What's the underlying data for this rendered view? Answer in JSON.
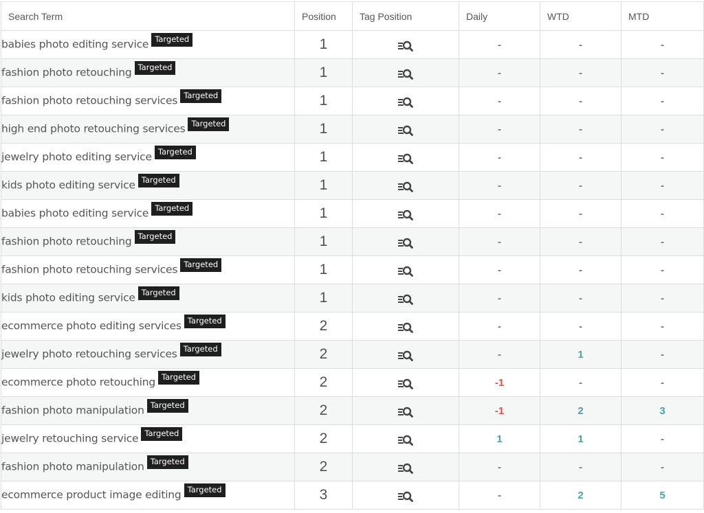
{
  "colors": {
    "positive": "#4aa3a2",
    "negative": "#d9534f",
    "badge_bg": "#1f1f1f",
    "row_alt_bg": "#f5f7f7"
  },
  "table": {
    "headers": {
      "search_term": "Search Term",
      "position": "Position",
      "tag_position": "Tag Position",
      "daily": "Daily",
      "wtd": "WTD",
      "mtd": "MTD"
    },
    "tag_icon": "list-search-icon",
    "rows": [
      {
        "term": "babies photo editing service",
        "badge": "Targeted",
        "position": "1",
        "daily": "-",
        "wtd": "-",
        "mtd": "-"
      },
      {
        "term": "fashion photo retouching",
        "badge": "Targeted",
        "position": "1",
        "daily": "-",
        "wtd": "-",
        "mtd": "-"
      },
      {
        "term": "fashion photo retouching services",
        "badge": "Targeted",
        "position": "1",
        "daily": "-",
        "wtd": "-",
        "mtd": "-"
      },
      {
        "term": "high end photo retouching services",
        "badge": "Targeted",
        "position": "1",
        "daily": "-",
        "wtd": "-",
        "mtd": "-"
      },
      {
        "term": "jewelry photo editing service",
        "badge": "Targeted",
        "position": "1",
        "daily": "-",
        "wtd": "-",
        "mtd": "-"
      },
      {
        "term": "kids photo editing service",
        "badge": "Targeted",
        "position": "1",
        "daily": "-",
        "wtd": "-",
        "mtd": "-"
      },
      {
        "term": "babies photo editing service",
        "badge": "Targeted",
        "position": "1",
        "daily": "-",
        "wtd": "-",
        "mtd": "-"
      },
      {
        "term": "fashion photo retouching",
        "badge": "Targeted",
        "position": "1",
        "daily": "-",
        "wtd": "-",
        "mtd": "-"
      },
      {
        "term": "fashion photo retouching services",
        "badge": "Targeted",
        "position": "1",
        "daily": "-",
        "wtd": "-",
        "mtd": "-"
      },
      {
        "term": "kids photo editing service",
        "badge": "Targeted",
        "position": "1",
        "daily": "-",
        "wtd": "-",
        "mtd": "-"
      },
      {
        "term": "ecommerce photo editing services",
        "badge": "Targeted",
        "position": "2",
        "daily": "-",
        "wtd": "-",
        "mtd": "-"
      },
      {
        "term": "jewelry photo retouching services",
        "badge": "Targeted",
        "position": "2",
        "daily": "-",
        "wtd": "1",
        "mtd": "-"
      },
      {
        "term": "ecommerce photo retouching",
        "badge": "Targeted",
        "position": "2",
        "daily": "-1",
        "wtd": "-",
        "mtd": "-"
      },
      {
        "term": "fashion photo manipulation",
        "badge": "Targeted",
        "position": "2",
        "daily": "-1",
        "wtd": "2",
        "mtd": "3"
      },
      {
        "term": "jewelry retouching service",
        "badge": "Targeted",
        "position": "2",
        "daily": "1",
        "wtd": "1",
        "mtd": "-"
      },
      {
        "term": "fashion photo manipulation",
        "badge": "Targeted",
        "position": "2",
        "daily": "-",
        "wtd": "-",
        "mtd": "-"
      },
      {
        "term": "ecommerce product image editing",
        "badge": "Targeted",
        "position": "3",
        "daily": "-",
        "wtd": "2",
        "mtd": "5"
      }
    ]
  }
}
